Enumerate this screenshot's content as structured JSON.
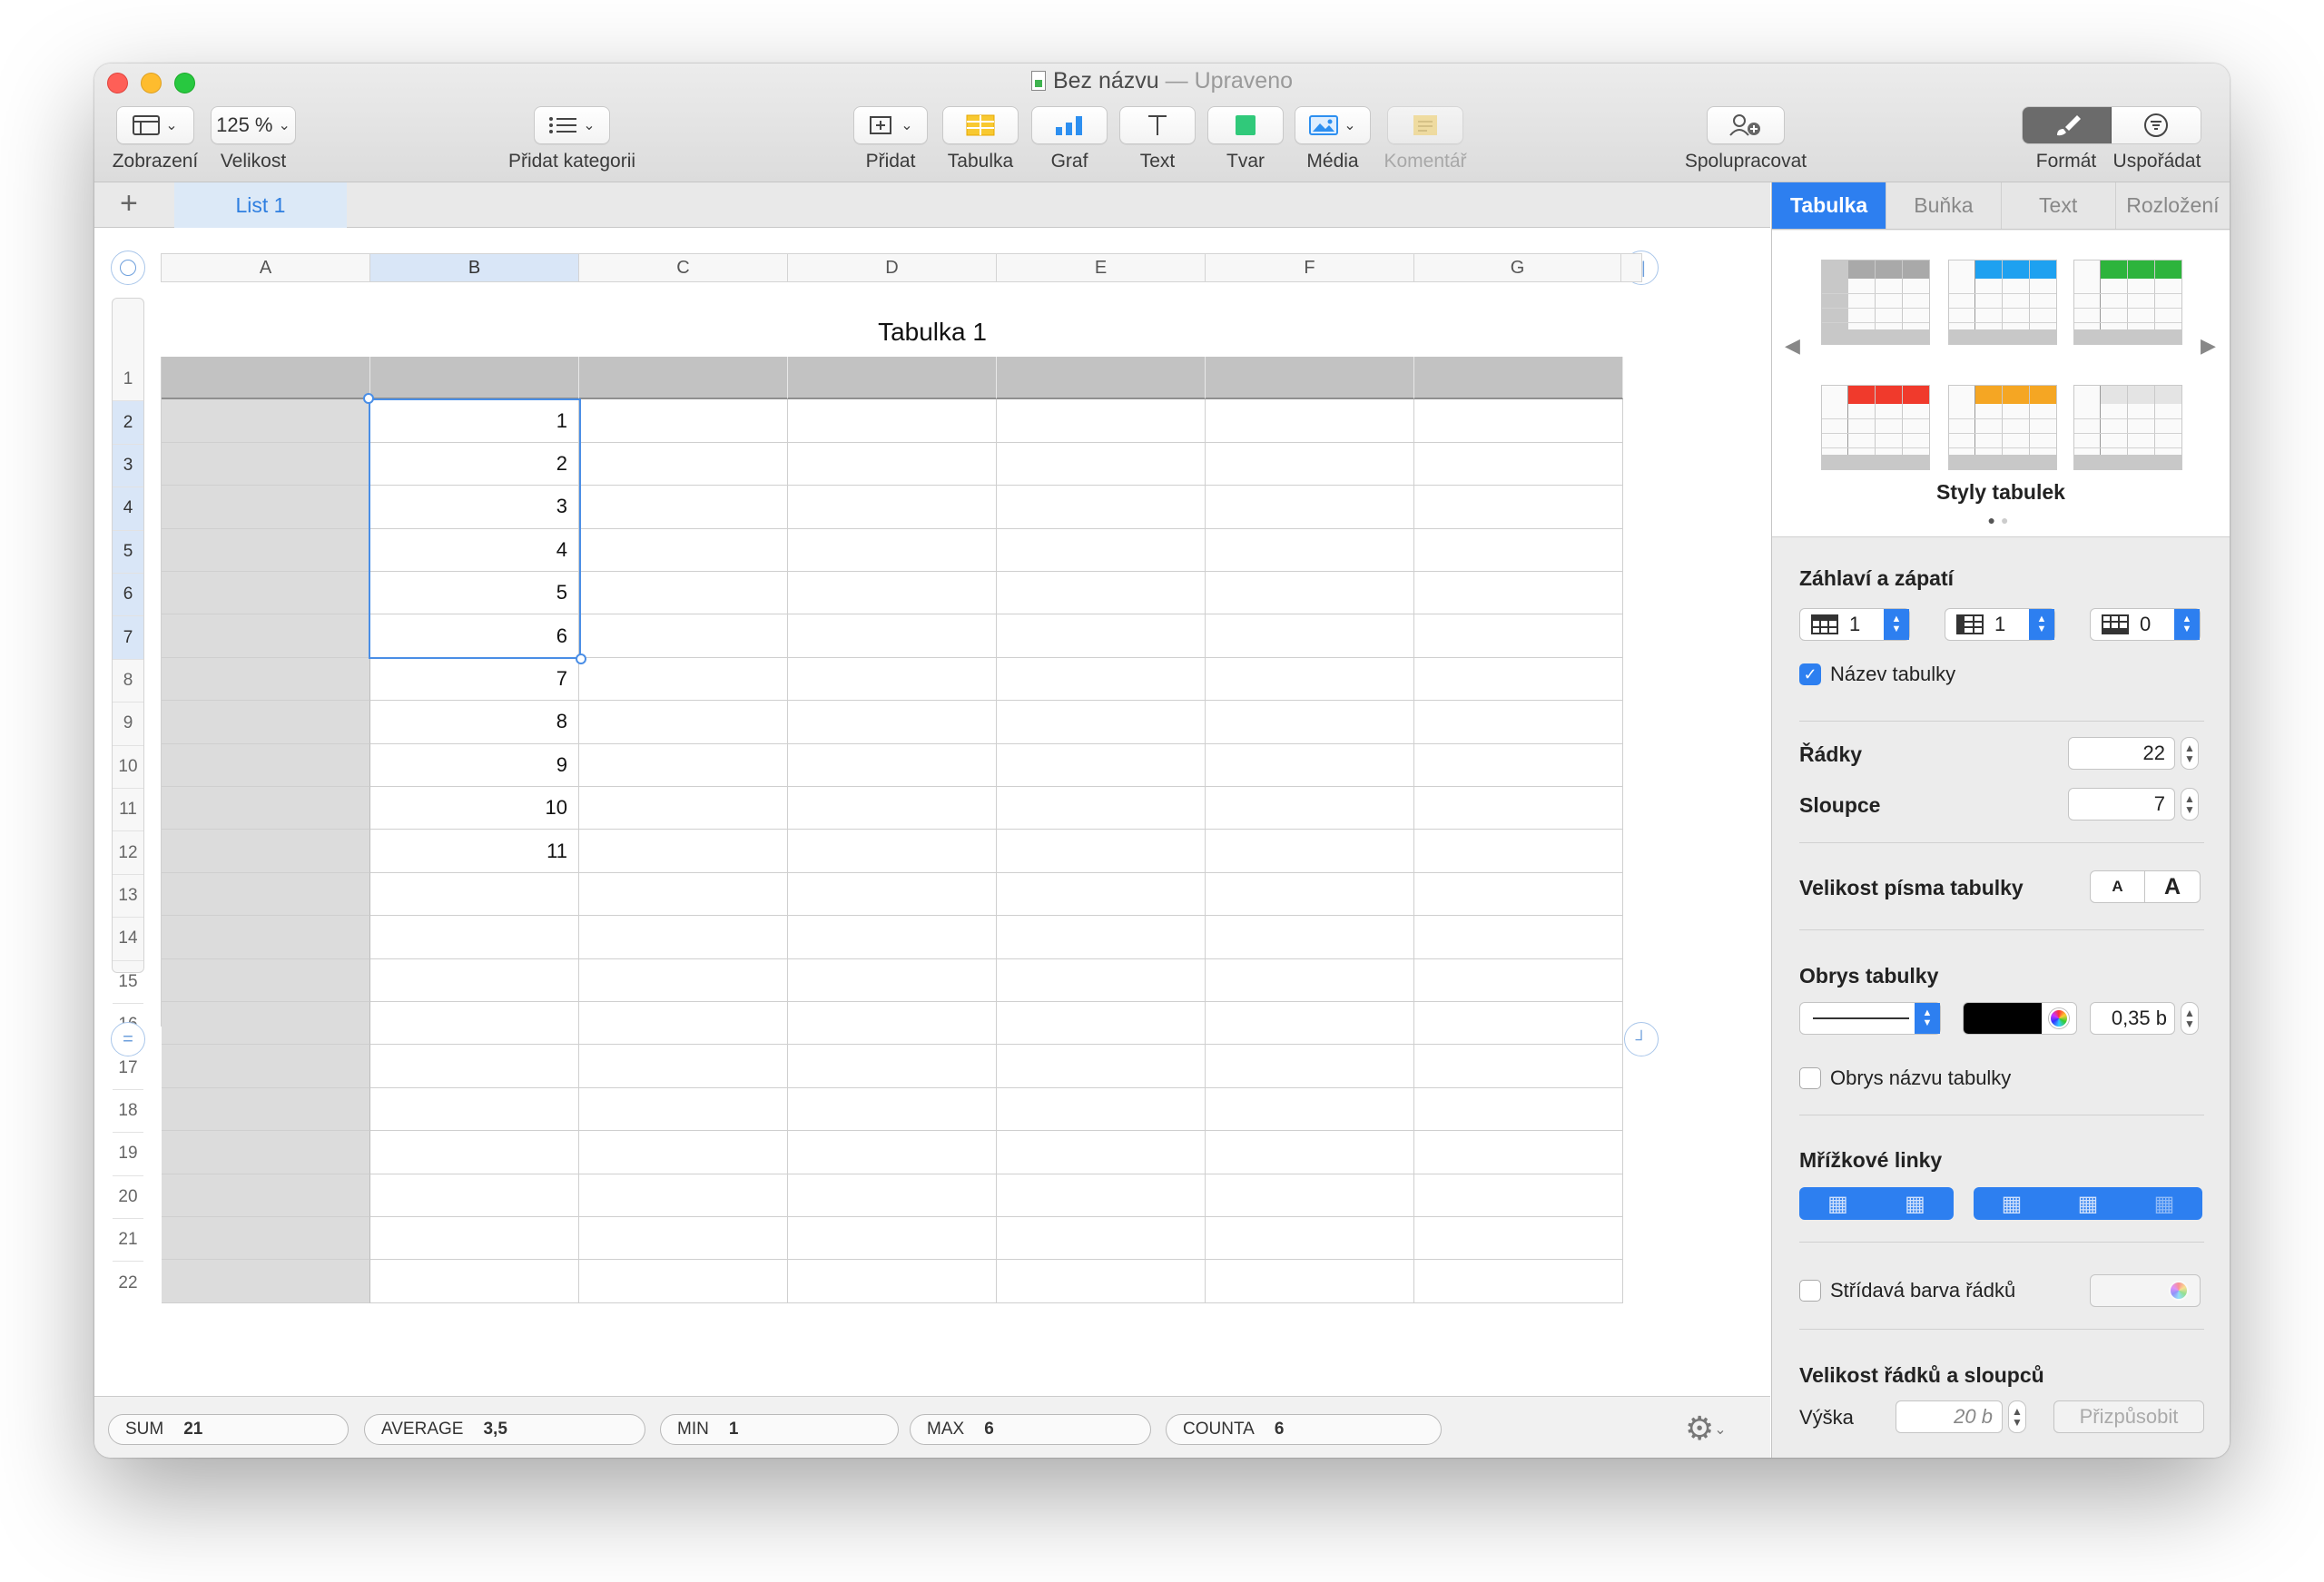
{
  "window": {
    "title": "Bez názvu",
    "title_separator": "—",
    "title_status": "Upraveno"
  },
  "toolbar": {
    "view_label": "Zobrazení",
    "zoom_value": "125 %",
    "zoom_label": "Velikost",
    "category_label": "Přidat kategorii",
    "insert_label": "Přidat",
    "table_label": "Tabulka",
    "chart_label": "Graf",
    "text_label": "Text",
    "shape_label": "Tvar",
    "media_label": "Média",
    "comment_label": "Komentář",
    "collaborate_label": "Spolupracovat",
    "format_label": "Formát",
    "organize_label": "Uspořádat"
  },
  "sheets": {
    "add": "+",
    "tabs": [
      "List 1"
    ]
  },
  "table": {
    "title": "Tabulka 1",
    "columns": [
      "A",
      "B",
      "C",
      "D",
      "E",
      "F",
      "G"
    ],
    "selected_column": "B",
    "rows": [
      "1",
      "2",
      "3",
      "4",
      "5",
      "6",
      "7",
      "8",
      "9",
      "10",
      "11",
      "12",
      "13",
      "14",
      "15",
      "16",
      "17",
      "18",
      "19",
      "20",
      "21",
      "22"
    ],
    "selected_rows": [
      2,
      3,
      4,
      5,
      6,
      7
    ],
    "column_b_values": [
      "",
      "1",
      "2",
      "3",
      "4",
      "5",
      "6",
      "7",
      "8",
      "9",
      "10",
      "11"
    ]
  },
  "status": {
    "sum_label": "SUM",
    "sum_value": "21",
    "average_label": "AVERAGE",
    "average_value": "3,5",
    "min_label": "MIN",
    "min_value": "1",
    "max_label": "MAX",
    "max_value": "6",
    "counta_label": "COUNTA",
    "counta_value": "6"
  },
  "inspector": {
    "tabs": [
      "Tabulka",
      "Buňka",
      "Text",
      "Rozložení"
    ],
    "styles_caption": "Styly tabulek",
    "style_colors": [
      "#a9a9a9",
      "#1ea1f0",
      "#2db43c",
      "#f03a2c",
      "#f5a623",
      "#e4e4e4"
    ],
    "headers_footers_title": "Záhlaví a zápatí",
    "header_rows": "1",
    "header_cols": "1",
    "footer_rows": "0",
    "table_name_label": "Název tabulky",
    "rows_label": "Řádky",
    "rows_value": "22",
    "cols_label": "Sloupce",
    "cols_value": "7",
    "font_size_label": "Velikost písma tabulky",
    "font_small": "A",
    "font_large": "A",
    "outline_title": "Obrys tabulky",
    "outline_width": "0,35 b",
    "outline_color": "#000000",
    "outline_name_label": "Obrys názvu tabulky",
    "gridlines_title": "Mřížkové linky",
    "alternating_label": "Střídavá barva řádků",
    "size_title": "Velikost řádků a sloupců",
    "height_label": "Výška",
    "height_value": "20 b",
    "fit_label": "Přizpůsobit"
  }
}
